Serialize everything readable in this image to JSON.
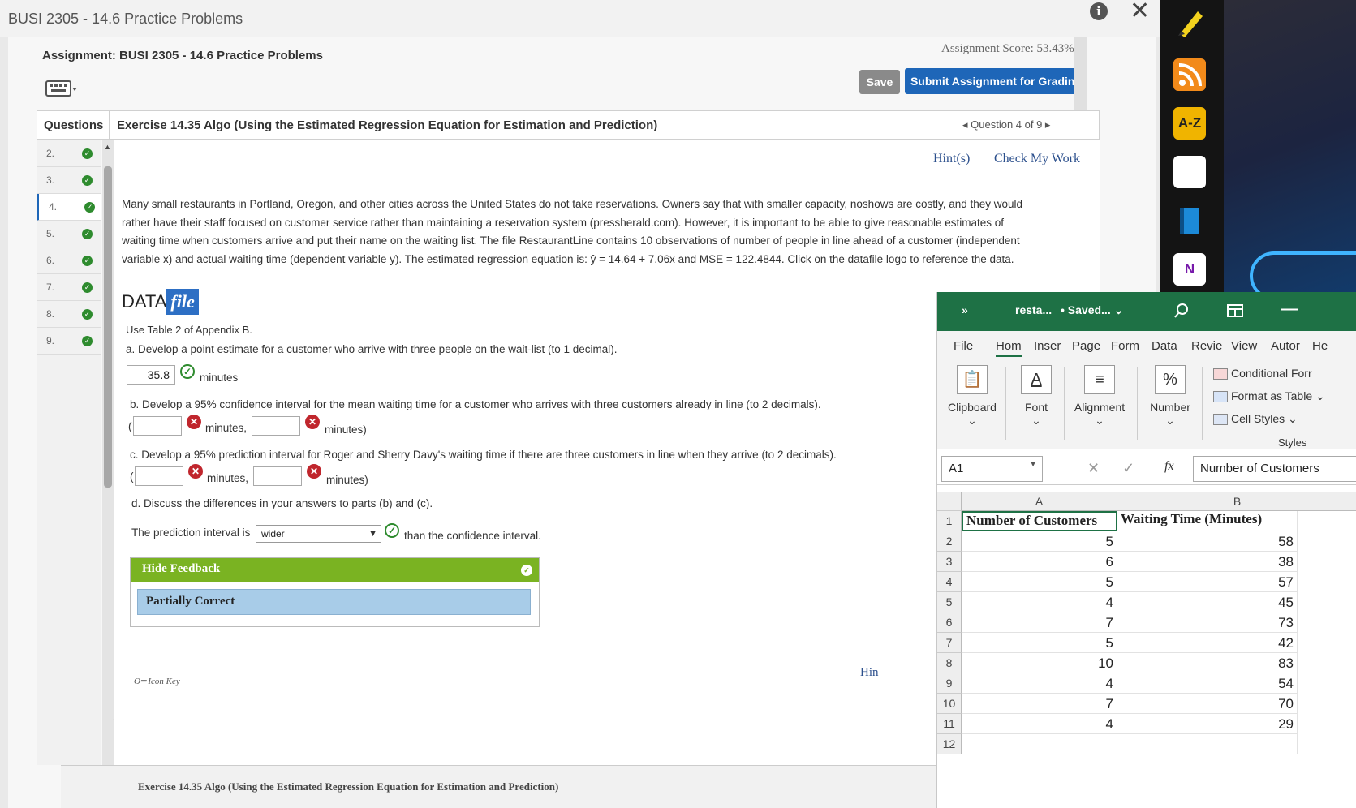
{
  "window": {
    "title": "BUSI 2305 - 14.6 Practice Problems"
  },
  "assignment": {
    "title": "Assignment: BUSI 2305 - 14.6 Practice Problems",
    "score": "Assignment Score: 53.43%",
    "save_label": "Save",
    "submit_label": "Submit Assignment for Grading"
  },
  "header": {
    "questions_label": "Questions",
    "exercise_title": "Exercise 14.35 Algo (Using the Estimated Regression Equation for Estimation and Prediction)",
    "question_nav": "◂ Question 4 of 9 ▸"
  },
  "question_list": [
    {
      "num": "2."
    },
    {
      "num": "3."
    },
    {
      "num": "4."
    },
    {
      "num": "5."
    },
    {
      "num": "6."
    },
    {
      "num": "7."
    },
    {
      "num": "8."
    },
    {
      "num": "9."
    }
  ],
  "links": {
    "hints": "Hint(s)",
    "check_work": "Check My Work"
  },
  "problem_text": "Many small restaurants in Portland, Oregon, and other cities across the United States do not take reservations. Owners say that with smaller capacity, noshows are costly, and they would rather have their staff focused on customer service rather than maintaining a reservation system (pressherald.com). However, it is important to be able to give reasonable estimates of waiting time when customers arrive and put their name on the waiting list. The file RestaurantLine contains 10 observations of number of people in line ahead of a customer (independent variable x) and actual waiting time (dependent variable y). The estimated regression equation is: ŷ = 14.64 + 7.06x and MSE = 122.4844. Click on the datafile logo to reference the data.",
  "datafile": {
    "data": "DATA",
    "file": "file"
  },
  "use_table": "Use Table 2 of Appendix B.",
  "parts": {
    "a": "a. Develop a point estimate for a customer who arrive with three people on the wait-list (to 1 decimal).",
    "a_value": "35.8",
    "minutes": "minutes",
    "minutes_comma": "minutes,",
    "minutes_close": "minutes)",
    "open_paren": "(",
    "b": "b. Develop a 95% confidence interval for the mean waiting time for a customer who arrives with three customers already in line (to 2 decimals).",
    "c": "c. Develop a 95% prediction interval for Roger and Sherry Davy's waiting time if there are three customers in line when they arrive (to 2 decimals).",
    "d": "d. Discuss the differences in your answers to parts (b) and (c).",
    "d_prefix": "The prediction interval is",
    "d_selected": "wider",
    "d_suffix": "than the confidence interval."
  },
  "feedback": {
    "header": "Hide Feedback",
    "status": "Partially Correct"
  },
  "icon_key": "Icon Key",
  "hint_fragment": "Hin",
  "bottom_title": "Exercise 14.35 Algo (Using the Estimated Regression Equation for Estimation and Prediction)",
  "dock": {
    "az_label": "A-Z",
    "onenote_label": "N"
  },
  "excel": {
    "title_chevrons": "»",
    "file_name": "resta...",
    "status": "• Saved... ⌄",
    "tabs": [
      "File",
      "Hom",
      "Inser",
      "Page",
      "Form",
      "Data",
      "Revie",
      "View",
      "Autor",
      "He"
    ],
    "groups": [
      "Clipboard",
      "Font",
      "Alignment",
      "Number"
    ],
    "styles_items": [
      "Conditional Forr",
      "Format as Table ⌄",
      "Cell Styles ⌄"
    ],
    "styles_label": "Styles",
    "name_box": "A1",
    "formula_content": "Number of Customers",
    "columns": [
      "A",
      "B"
    ],
    "rows": [
      {
        "row": "1",
        "a": "Number of Customers",
        "b": "Waiting Time (Minutes)"
      },
      {
        "row": "2",
        "a": "5",
        "b": "58"
      },
      {
        "row": "3",
        "a": "6",
        "b": "38"
      },
      {
        "row": "4",
        "a": "5",
        "b": "57"
      },
      {
        "row": "5",
        "a": "4",
        "b": "45"
      },
      {
        "row": "6",
        "a": "7",
        "b": "73"
      },
      {
        "row": "7",
        "a": "5",
        "b": "42"
      },
      {
        "row": "8",
        "a": "10",
        "b": "83"
      },
      {
        "row": "9",
        "a": "4",
        "b": "54"
      },
      {
        "row": "10",
        "a": "7",
        "b": "70"
      },
      {
        "row": "11",
        "a": "4",
        "b": "29"
      },
      {
        "row": "12",
        "a": "",
        "b": ""
      }
    ]
  },
  "colors": {
    "brand_blue": "#1e66b8",
    "correct_green": "#2e8b2e",
    "wrong_red": "#c0262d",
    "feedback_green": "#7ab322",
    "excel_green": "#1e7145"
  }
}
